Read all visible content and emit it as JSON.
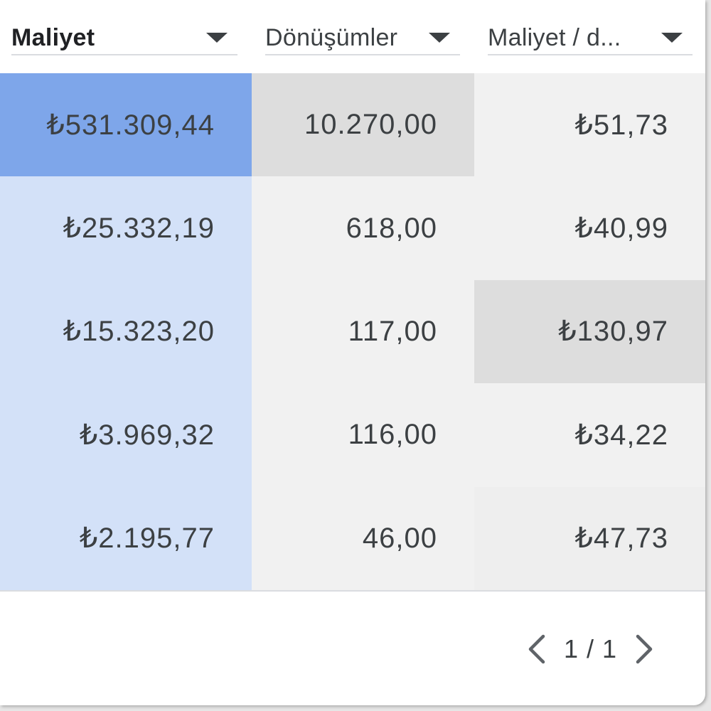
{
  "table": {
    "columns": [
      {
        "label": "Maliyet",
        "bold": true
      },
      {
        "label": "Dönüşümler",
        "bold": false
      },
      {
        "label": "Maliyet / d...",
        "bold": false
      }
    ],
    "rows": [
      {
        "cost": "₺531.309,44",
        "conversions": "10.270,00",
        "cost_per_conv": "₺51,73"
      },
      {
        "cost": "₺25.332,19",
        "conversions": "618,00",
        "cost_per_conv": "₺40,99"
      },
      {
        "cost": "₺15.323,20",
        "conversions": "117,00",
        "cost_per_conv": "₺130,97"
      },
      {
        "cost": "₺3.969,32",
        "conversions": "116,00",
        "cost_per_conv": "₺34,22"
      },
      {
        "cost": "₺2.195,77",
        "conversions": "46,00",
        "cost_per_conv": "₺47,73"
      }
    ],
    "cell_colors": [
      [
        "#7ea6ea",
        "#dddddd",
        "#f1f1f1"
      ],
      [
        "#d3e1f8",
        "#f1f1f1",
        "#f1f1f1"
      ],
      [
        "#d3e1f8",
        "#f1f1f1",
        "#dddddd"
      ],
      [
        "#d3e1f8",
        "#f1f1f1",
        "#f1f1f1"
      ],
      [
        "#d3e1f8",
        "#f1f1f1",
        "#eeeeee"
      ]
    ]
  },
  "pagination": {
    "text": "1 / 1",
    "prev_icon": "chevron-left-icon",
    "next_icon": "chevron-right-icon"
  }
}
